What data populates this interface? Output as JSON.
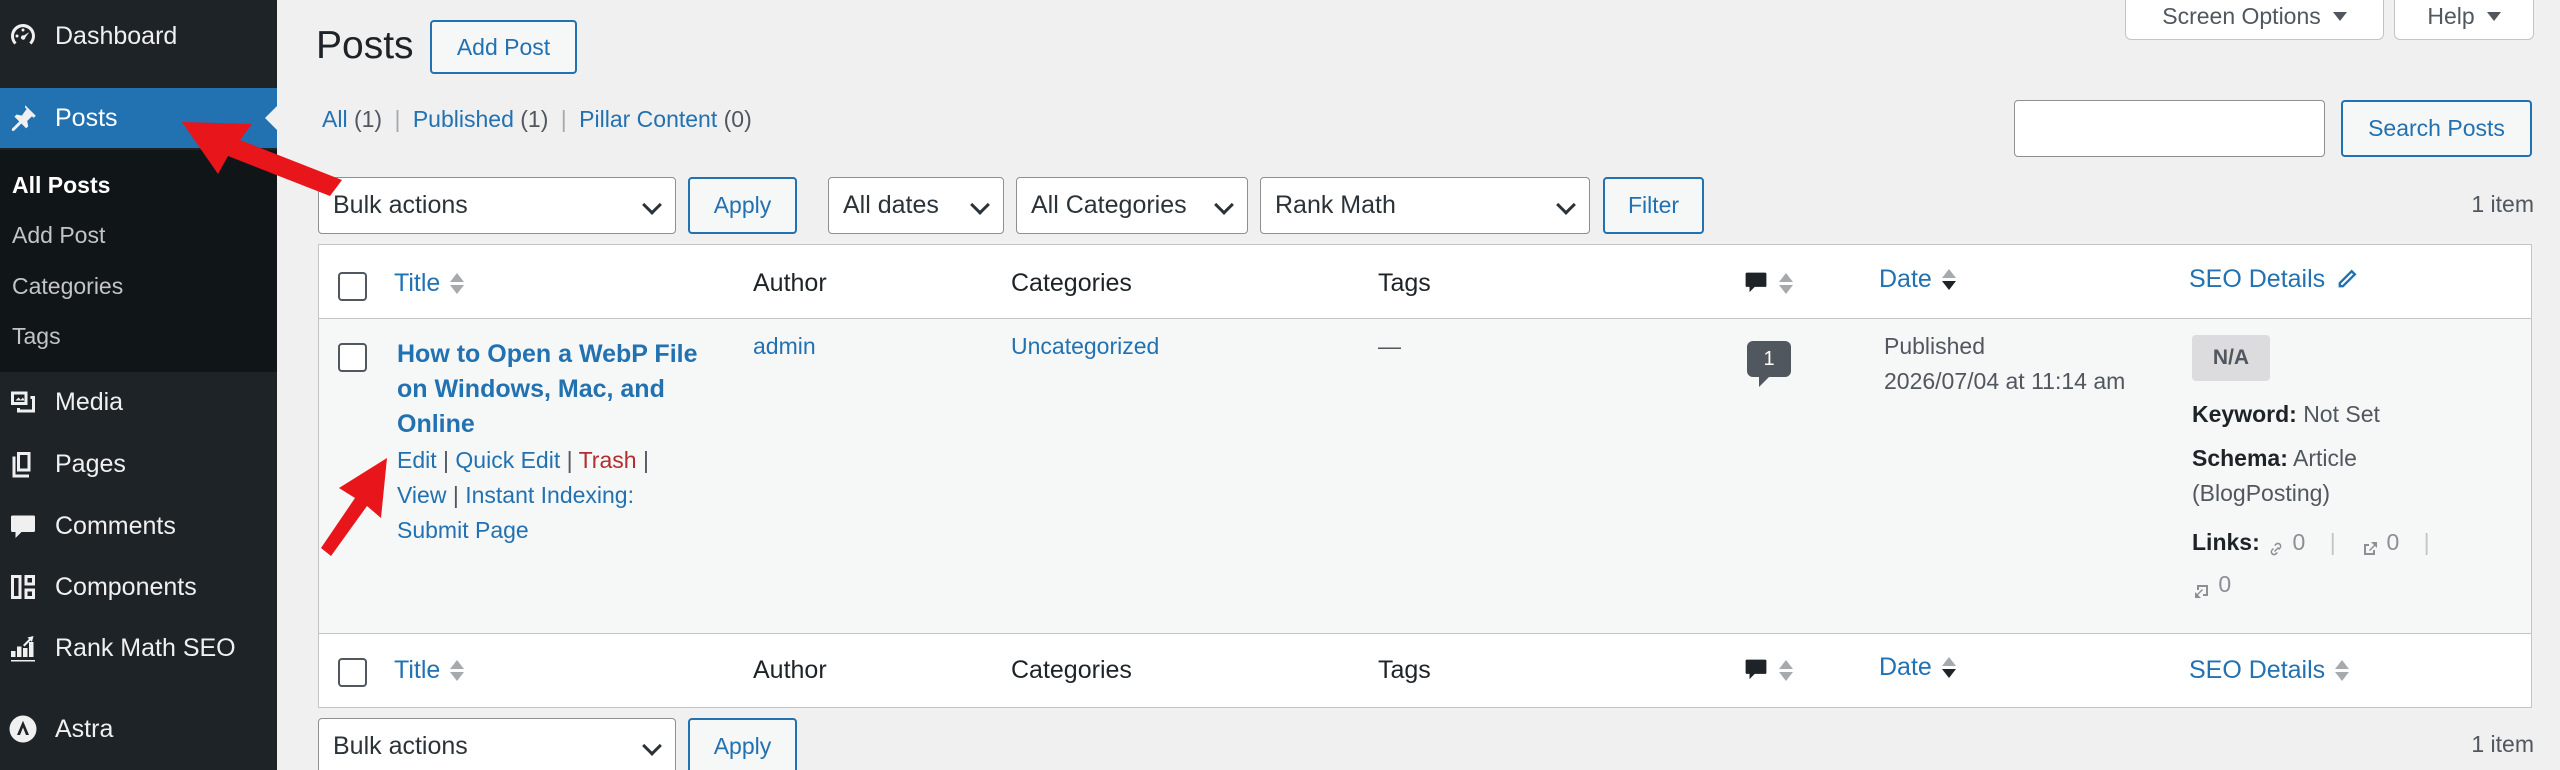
{
  "sidebar": {
    "items": [
      {
        "label": "Dashboard",
        "icon": "dashboard-icon"
      },
      {
        "label": "Posts",
        "icon": "pin-icon"
      },
      {
        "label": "Media",
        "icon": "media-icon"
      },
      {
        "label": "Pages",
        "icon": "pages-icon"
      },
      {
        "label": "Comments",
        "icon": "comments-icon"
      },
      {
        "label": "Components",
        "icon": "components-icon"
      },
      {
        "label": "Rank Math SEO",
        "icon": "rank-math-icon"
      },
      {
        "label": "Astra",
        "icon": "astra-icon"
      }
    ],
    "submenu": [
      "All Posts",
      "Add Post",
      "Categories",
      "Tags"
    ]
  },
  "header": {
    "title": "Posts",
    "add_button": "Add Post",
    "screen_options": "Screen Options",
    "help": "Help"
  },
  "status": {
    "all_label": "All",
    "all_count": "(1)",
    "published_label": "Published",
    "published_count": "(1)",
    "pillar_label": "Pillar Content",
    "pillar_count": "(0)",
    "separator": "|"
  },
  "search": {
    "button": "Search Posts",
    "value": ""
  },
  "filters": {
    "bulk_actions": "Bulk actions",
    "apply": "Apply",
    "dates": "All dates",
    "categories": "All Categories",
    "rank_math": "Rank Math",
    "filter": "Filter",
    "items_count": "1 item"
  },
  "table": {
    "columns": {
      "title": "Title",
      "author": "Author",
      "categories": "Categories",
      "tags": "Tags",
      "date": "Date",
      "seo": "SEO Details"
    },
    "row": {
      "title": "How to Open a WebP File on Windows, Mac, and Online",
      "actions": {
        "edit": "Edit",
        "quick_edit": "Quick Edit",
        "trash": "Trash",
        "view": "View",
        "instant_indexing": "Instant Indexing: Submit Page",
        "sep": "|"
      },
      "author": "admin",
      "category": "Uncategorized",
      "tags": "—",
      "comments": "1",
      "date_status": "Published",
      "date_value": "2026/07/04 at 11:14 am",
      "seo_badge": "N/A",
      "keyword_label": "Keyword:",
      "keyword_value": "Not Set",
      "schema_label": "Schema:",
      "schema_value": "Article (BlogPosting)",
      "links_label": "Links:",
      "internal_links": "0",
      "external_links": "0",
      "incoming_links": "0"
    }
  },
  "colors": {
    "accent": "#2271b1",
    "sidebar": "#1d2327",
    "trash": "#b32d2e",
    "arrow": "#e8151b"
  }
}
